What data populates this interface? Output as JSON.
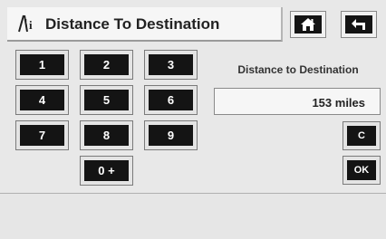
{
  "header": {
    "title": "Distance To Destination",
    "title_icon": "road-distance-icon",
    "home_icon": "home-icon",
    "back_icon": "back-arrow-icon"
  },
  "keypad": {
    "keys": [
      "1",
      "2",
      "3",
      "4",
      "5",
      "6",
      "7",
      "8",
      "9"
    ],
    "zero_key": "0 +"
  },
  "distance": {
    "label": "Distance to Destination",
    "value": "153 miles"
  },
  "actions": {
    "clear_label": "C",
    "ok_label": "OK"
  }
}
